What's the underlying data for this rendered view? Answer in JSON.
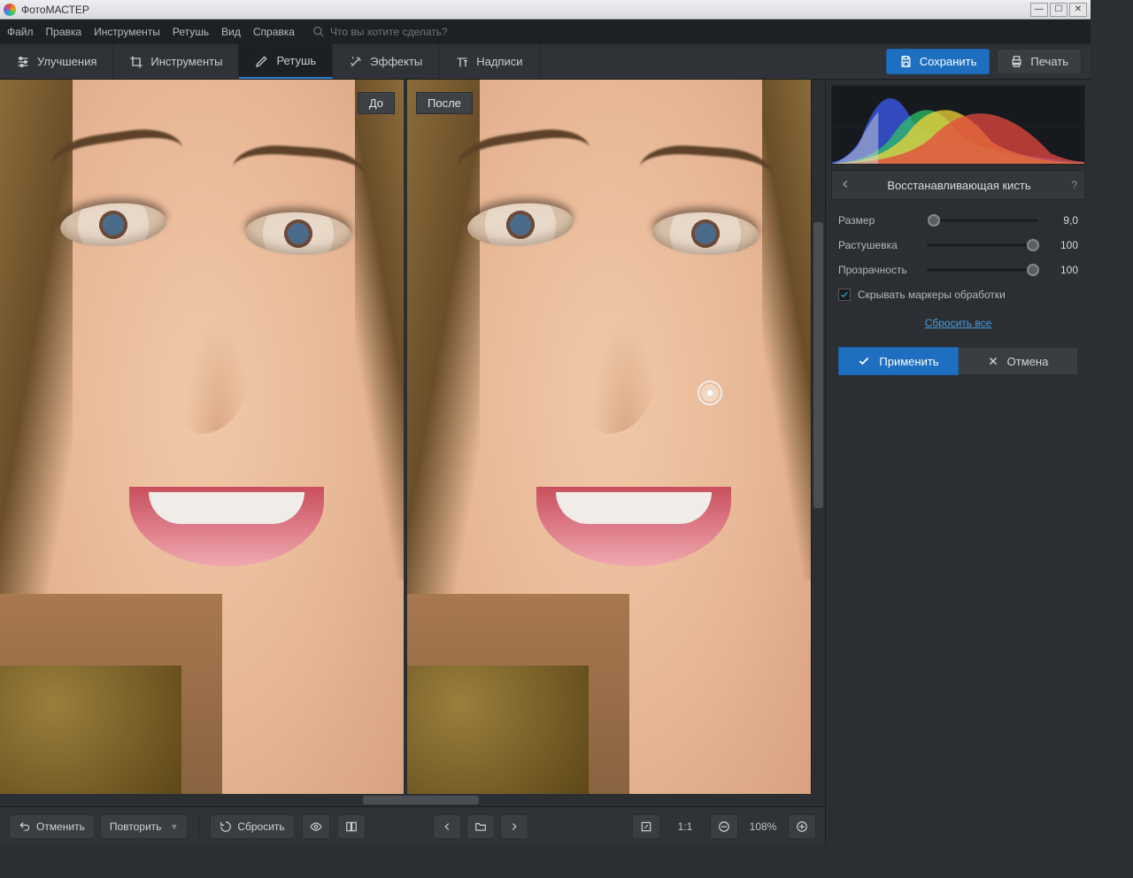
{
  "app_title": "ФотоМАСТЕР",
  "menu": {
    "file": "Файл",
    "edit": "Правка",
    "tools": "Инструменты",
    "retouch": "Ретушь",
    "view": "Вид",
    "help": "Справка",
    "search_placeholder": "Что вы хотите сделать?"
  },
  "tabs": {
    "enhance": "Улучшения",
    "tools": "Инструменты",
    "retouch": "Ретушь",
    "effects": "Эффекты",
    "text": "Надписи"
  },
  "header_buttons": {
    "save": "Сохранить",
    "print": "Печать"
  },
  "compare": {
    "before": "До",
    "after": "После"
  },
  "panel": {
    "title": "Восстанавливающая кисть",
    "size_label": "Размер",
    "size_value": "9,0",
    "feather_label": "Растушевка",
    "feather_value": "100",
    "opacity_label": "Прозрачность",
    "opacity_value": "100",
    "hide_markers": "Скрывать маркеры обработки",
    "reset_all": "Сбросить все",
    "apply": "Применить",
    "cancel": "Отмена"
  },
  "footer": {
    "undo": "Отменить",
    "redo": "Повторить",
    "reset": "Сбросить",
    "zoom": "108%",
    "ratio": "1:1"
  }
}
